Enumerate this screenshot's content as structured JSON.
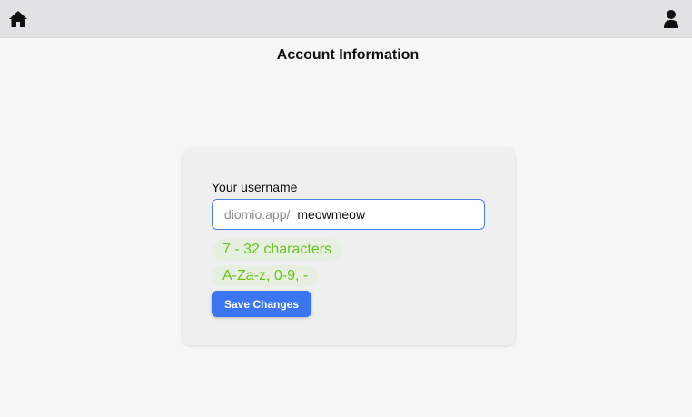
{
  "topbar": {
    "home_icon": "home-icon",
    "user_icon": "user-icon"
  },
  "page": {
    "title": "Account Information"
  },
  "form": {
    "username_label": "Your username",
    "url_prefix": "diomio.app/",
    "username_value": "meowmeow",
    "hints": [
      "7 - 32 characters",
      "A-Za-z, 0-9, -"
    ],
    "save_label": "Save Changes"
  },
  "colors": {
    "accent": "#3b76f0",
    "hint_text": "#6bc41a",
    "topbar_bg": "#e2e2e4",
    "page_bg": "#f6f6f6"
  }
}
